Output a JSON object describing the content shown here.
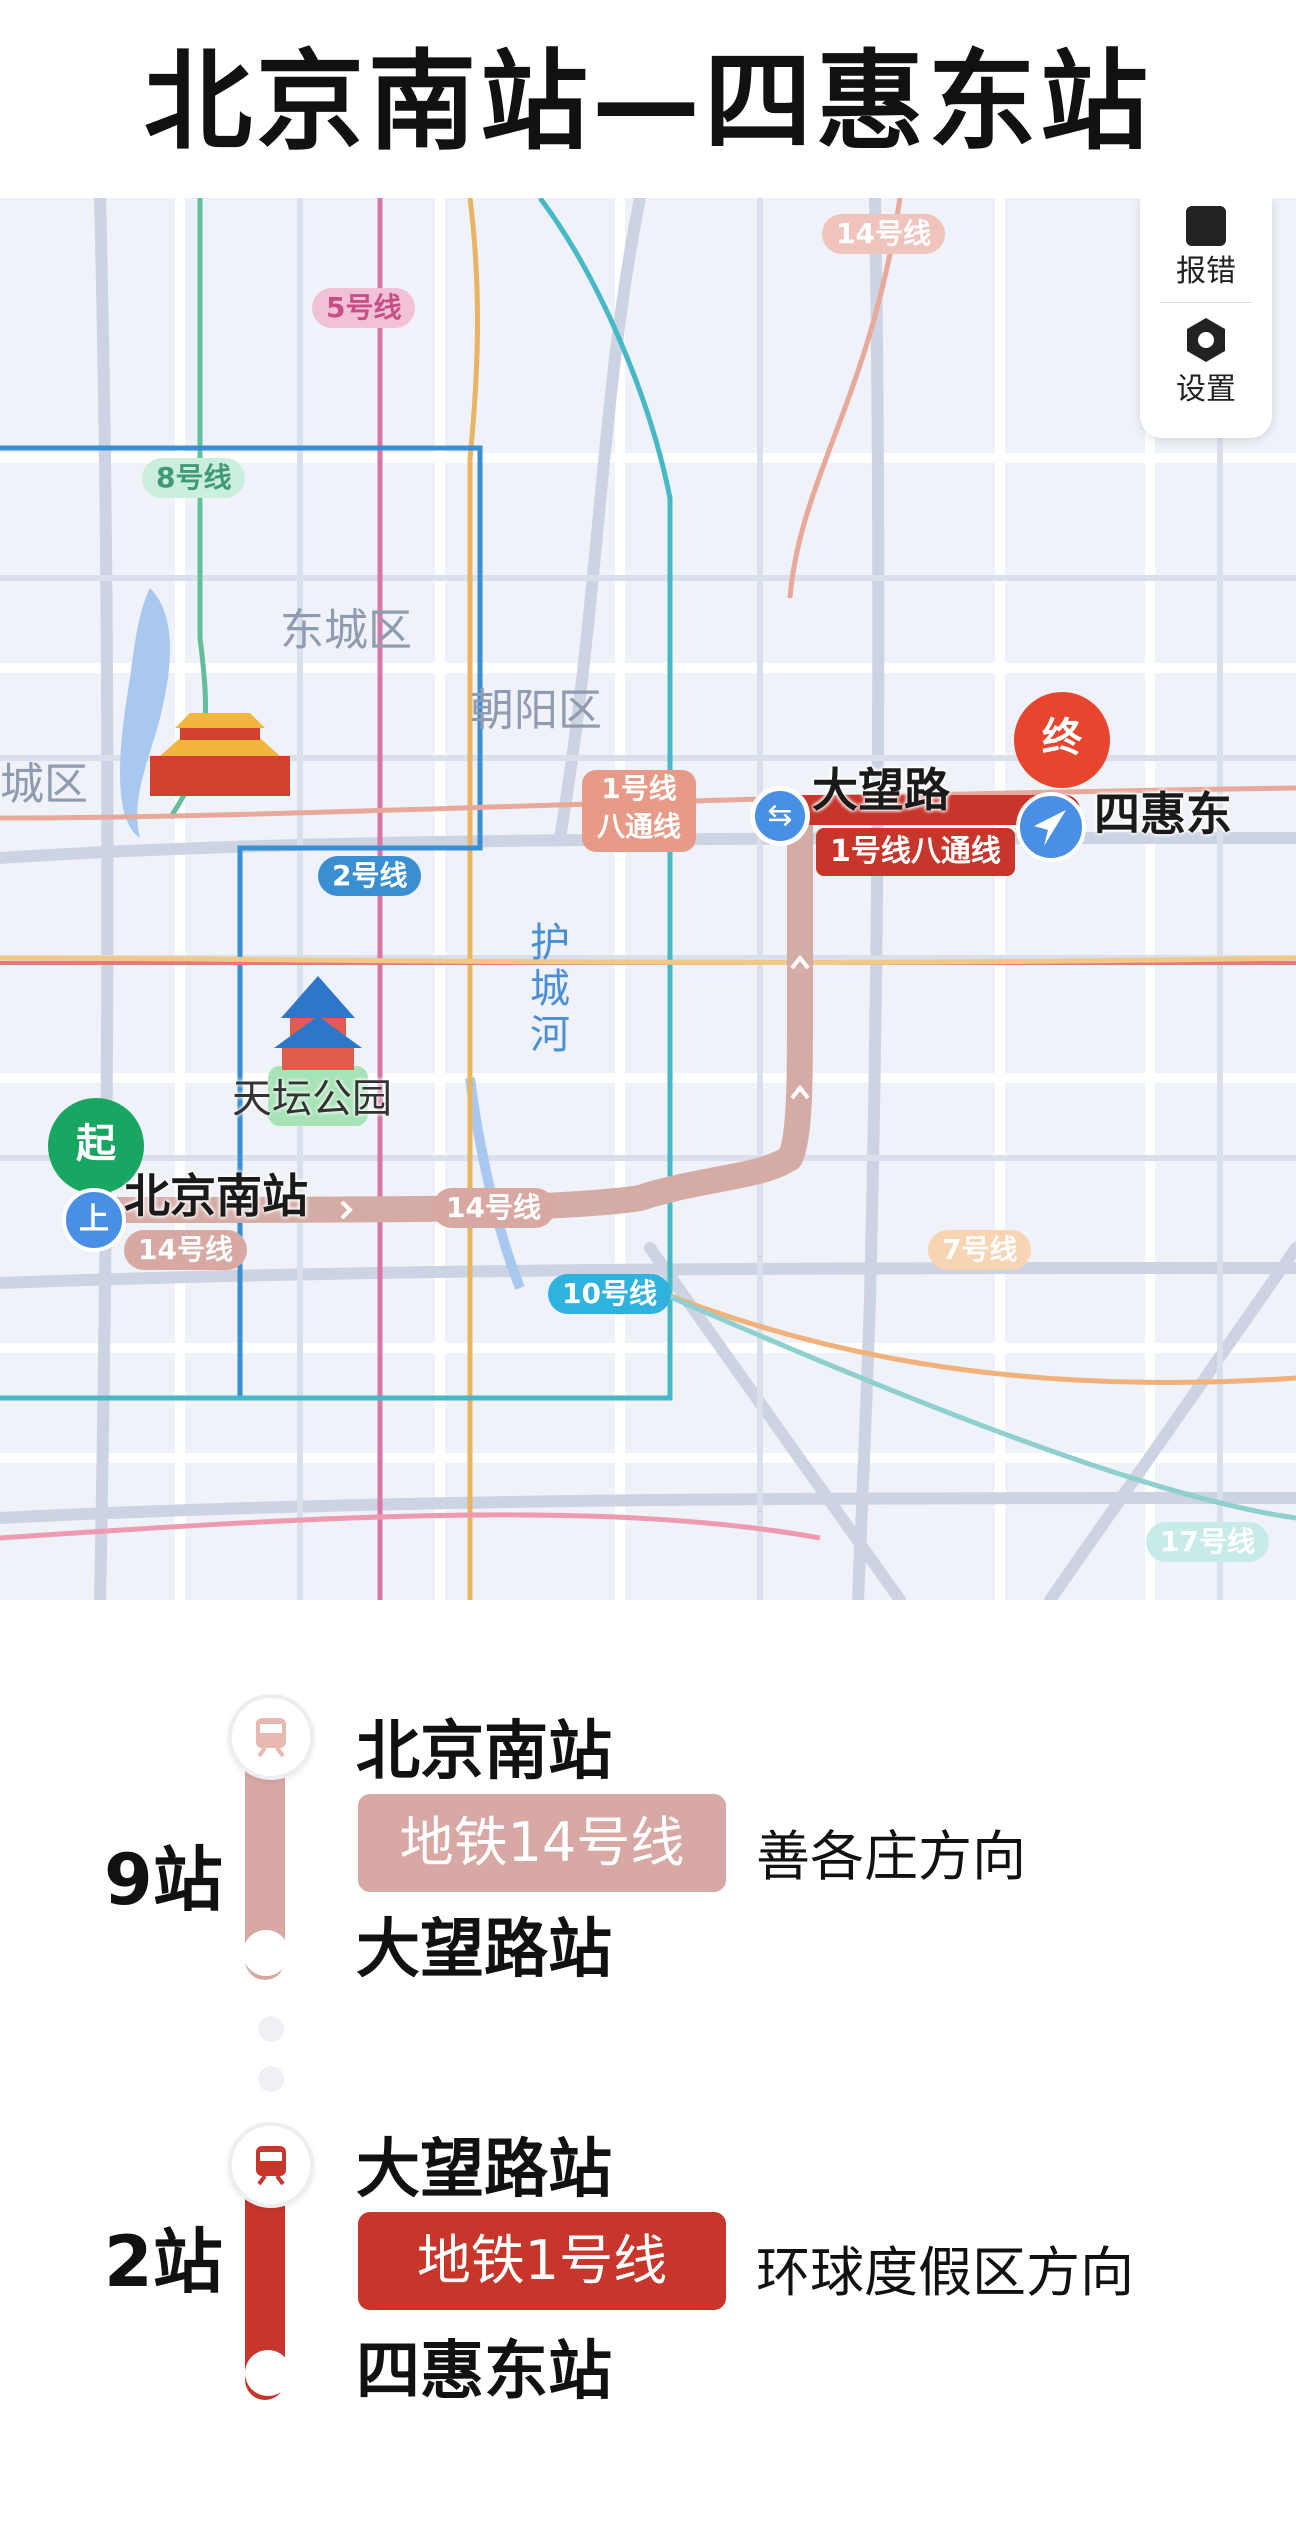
{
  "page": {
    "title": "北京南站—四惠东站"
  },
  "map": {
    "controls": {
      "report_label": "报错",
      "settings_label": "设置"
    },
    "line_labels": [
      {
        "id": "14-top",
        "text": "14号线",
        "color": "#e8a29a"
      },
      {
        "id": "5",
        "text": "5号线",
        "color": "#cf6a96"
      },
      {
        "id": "8",
        "text": "8号线",
        "color": "#62bf9a"
      },
      {
        "id": "2",
        "text": "2号线",
        "color": "#3a8fd2"
      },
      {
        "id": "1-batong",
        "text": "1号线\n八通线",
        "color": "#d0745f"
      },
      {
        "id": "14-route",
        "text": "14号线",
        "color": "#d8a8a2"
      },
      {
        "id": "14-left",
        "text": "14号线",
        "color": "#d8a8a2"
      },
      {
        "id": "10",
        "text": "10号线",
        "color": "#2fb2de"
      },
      {
        "id": "7",
        "text": "7号线",
        "color": "#f0b27a"
      },
      {
        "id": "17",
        "text": "17号线",
        "color": "#8fd0cf"
      },
      {
        "id": "route-1",
        "text": "1号线八通线",
        "color": "#c0392b"
      }
    ],
    "districts": [
      "东城区",
      "朝阳区",
      "城区"
    ],
    "river": "护城河",
    "poi": {
      "temple_of_heaven": "天坛公园"
    },
    "stations": {
      "start": "北京南站",
      "transfer": "大望路",
      "end": "四惠东"
    },
    "pins": {
      "start": "起",
      "end": "终",
      "board": "上"
    }
  },
  "segments": [
    {
      "count": "9站",
      "from": "北京南站",
      "line": "地铁14号线",
      "direction": "善各庄方向",
      "to": "大望路站",
      "color": "#d8a8a4"
    },
    {
      "count": "2站",
      "from": "大望路站",
      "line": "地铁1号线",
      "direction": "环球度假区方向",
      "to": "四惠东站",
      "color": "#c7352b"
    }
  ]
}
